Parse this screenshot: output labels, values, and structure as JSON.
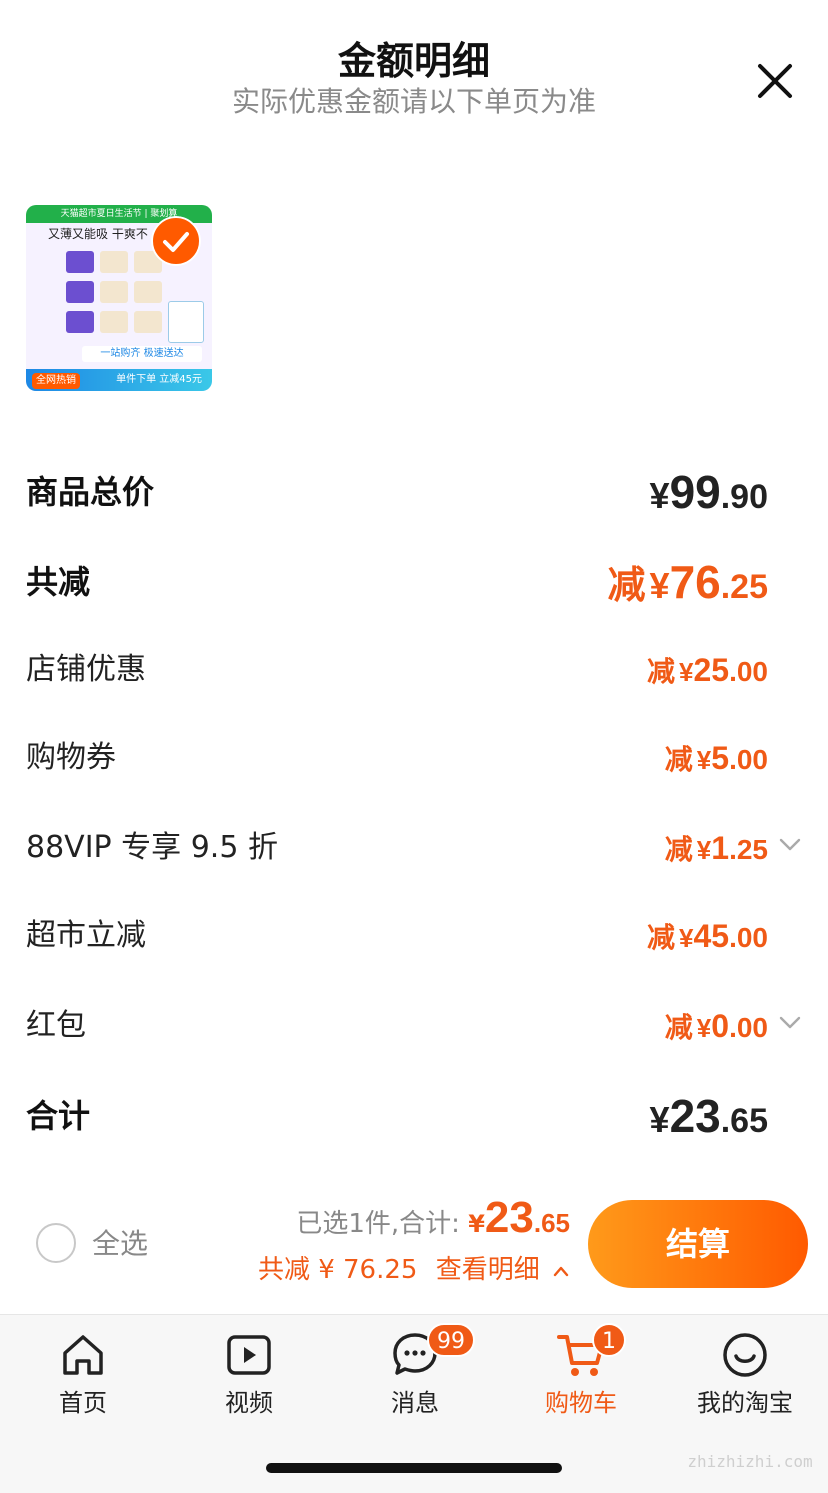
{
  "header": {
    "title": "金额明细",
    "subtitle": "实际优惠金额请以下单页为准"
  },
  "product_image": {
    "banner": "天猫超市夏日生活节 | 聚划算",
    "slogan": "又薄又能吸 干爽不",
    "middle": "一站购齐 极速送达",
    "bottom": "单件下单 立减45元",
    "tag": "全网热销",
    "checked": true
  },
  "rows": [
    {
      "label": "商品总价",
      "prefix": "",
      "currency": "¥",
      "int": "99",
      "dec": ".90",
      "style": "total"
    },
    {
      "label": "共减",
      "prefix": "减",
      "currency": "¥",
      "int": "76",
      "dec": ".25",
      "style": "discount_total"
    },
    {
      "label": "店铺优惠",
      "prefix": "减",
      "currency": "¥",
      "int": "25",
      "dec": ".00",
      "style": "discount"
    },
    {
      "label": "购物券",
      "prefix": "减",
      "currency": "¥",
      "int": "5",
      "dec": ".00",
      "style": "discount"
    },
    {
      "label": "88VIP 专享 9.5 折",
      "prefix": "减",
      "currency": "¥",
      "int": "1",
      "dec": ".25",
      "style": "discount",
      "expandable": true
    },
    {
      "label": "超市立减",
      "prefix": "减",
      "currency": "¥",
      "int": "45",
      "dec": ".00",
      "style": "discount"
    },
    {
      "label": "红包",
      "prefix": "减",
      "currency": "¥",
      "int": "0",
      "dec": ".00",
      "style": "discount",
      "expandable": true
    },
    {
      "label": "合计",
      "prefix": "",
      "currency": "¥",
      "int": "23",
      "dec": ".65",
      "style": "total"
    }
  ],
  "footer": {
    "select_all": "全选",
    "selected_text": "已选1件,合计:",
    "total_currency": "¥",
    "total_int": "23",
    "total_dec": ".65",
    "discount_text": "共减 ¥ 76.25",
    "view_detail": "查看明细",
    "checkout": "结算"
  },
  "tabs": [
    {
      "label": "首页",
      "icon": "home-icon"
    },
    {
      "label": "视频",
      "icon": "video-icon"
    },
    {
      "label": "消息",
      "icon": "message-icon",
      "badge": "99"
    },
    {
      "label": "购物车",
      "icon": "cart-icon",
      "badge": "1",
      "active": true
    },
    {
      "label": "我的淘宝",
      "icon": "profile-icon"
    }
  ],
  "watermark": "zhizhizhi.com",
  "colors": {
    "accent": "#f05a16",
    "checkout_start": "#ff9a1a",
    "checkout_end": "#ff5a00"
  }
}
